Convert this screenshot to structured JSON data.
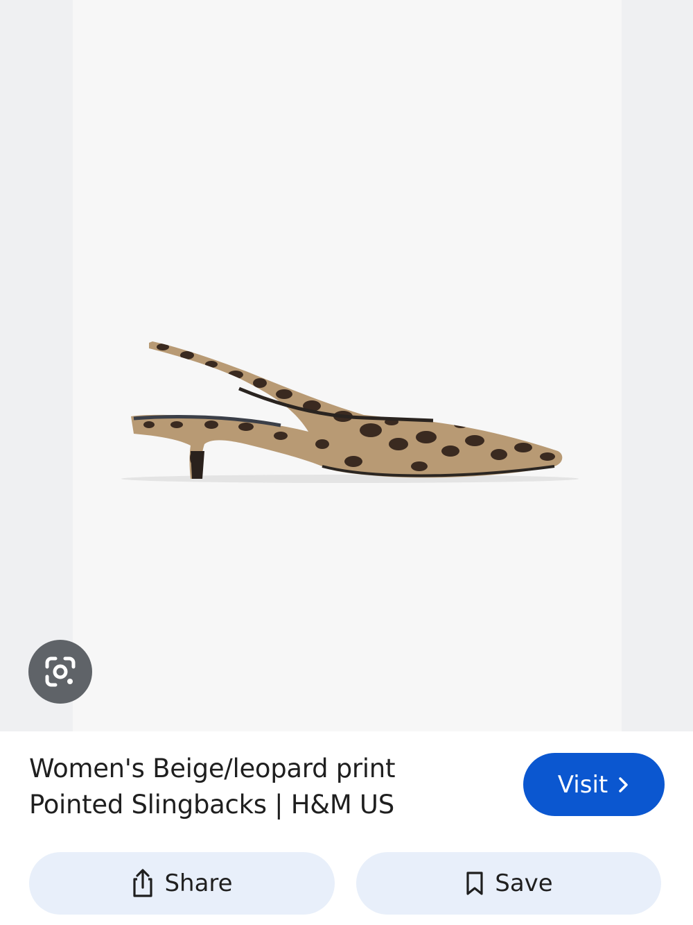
{
  "product": {
    "title_line1": "Women's Beige/leopard print",
    "title_line2": "Pointed Slingbacks | H&M US",
    "image_subject": "leopard print slingback kitten heel shoe"
  },
  "actions": {
    "visit_label": "Visit",
    "share_label": "Share",
    "save_label": "Save"
  },
  "icons": {
    "lens": "google-lens-icon",
    "visit": "chevron-right-icon",
    "share": "share-icon",
    "save": "bookmark-icon"
  },
  "colors": {
    "accent": "#0b57d0",
    "action_bg": "#e8effa",
    "lens_bg": "#5f6368",
    "text": "#1f1f1f"
  }
}
